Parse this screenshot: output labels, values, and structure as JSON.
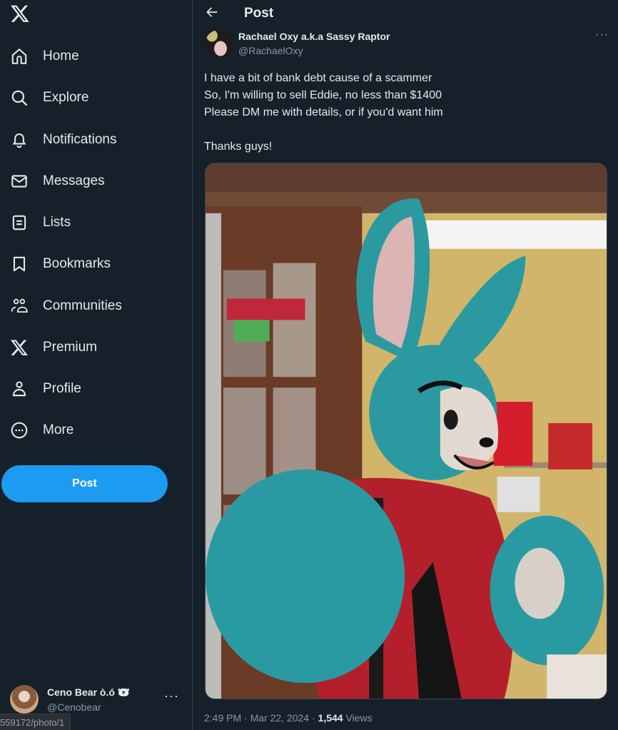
{
  "sidebar": {
    "logo": "x-logo-icon",
    "items": [
      {
        "label": "Home",
        "icon": "home-icon"
      },
      {
        "label": "Explore",
        "icon": "search-icon"
      },
      {
        "label": "Notifications",
        "icon": "bell-icon"
      },
      {
        "label": "Messages",
        "icon": "envelope-icon"
      },
      {
        "label": "Lists",
        "icon": "list-icon"
      },
      {
        "label": "Bookmarks",
        "icon": "bookmark-icon"
      },
      {
        "label": "Communities",
        "icon": "communities-icon"
      },
      {
        "label": "Premium",
        "icon": "x-logo-icon"
      },
      {
        "label": "Profile",
        "icon": "person-icon"
      },
      {
        "label": "More",
        "icon": "more-circle-icon"
      }
    ],
    "post_button": "Post",
    "account": {
      "name": "Ceno Bear ò.ó 🐻‍❄️",
      "handle": "@Cenobear",
      "more": "···"
    },
    "status_url": "559172/photo/1"
  },
  "header": {
    "back_icon": "arrow-left-icon",
    "title": "Post"
  },
  "post": {
    "author_name": "Rachael Oxy a.k.a Sassy Raptor",
    "author_handle": "@RachaelOxy",
    "more": "···",
    "text_lines": [
      "I have a bit of bank debt cause of a scammer",
      "So, I'm willing to sell Eddie, no less than $1400",
      "Please DM me with details, or if you'd want him",
      "",
      "Thanks guys!"
    ],
    "media_alt": "Photo of a teal rabbit fursuit wearing a red hoodie in a pantry",
    "time": "2:49 PM",
    "date": "Mar 22, 2024",
    "views_count": "1,544",
    "views_label": "Views",
    "separator": "·"
  },
  "colors": {
    "background": "#15202b",
    "accent": "#1d9bf0",
    "text_primary": "#e7e9ea",
    "text_secondary": "#8b98a5",
    "border": "#38444d"
  }
}
